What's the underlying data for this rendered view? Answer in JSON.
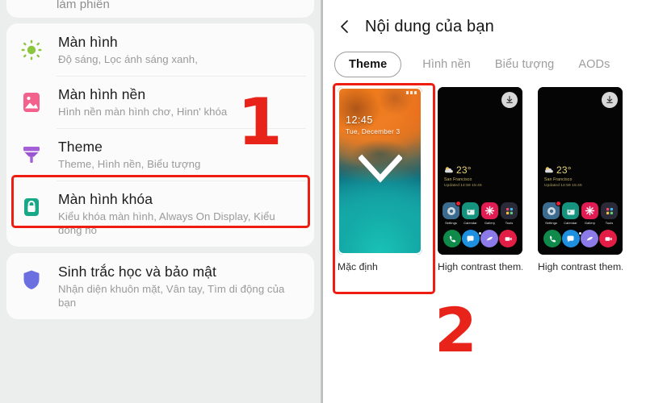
{
  "left_panel": {
    "partial_card_text": "làm phiền",
    "items": [
      {
        "title": "Màn hình",
        "subtitle": "Độ sáng, Lọc ánh sáng xanh,",
        "icon": "brightness-sun-icon",
        "icon_color": "#8cc63e"
      },
      {
        "title": "Màn hình nền",
        "subtitle": "Hình nền màn hình chơ, Hinn' khóa",
        "icon": "wallpaper-image-icon",
        "icon_color": "#f2628c"
      },
      {
        "title": "Theme",
        "subtitle": "Theme, Hình nền, Biểu tượng",
        "icon": "paint-roller-icon",
        "icon_color": "#a560d8"
      },
      {
        "title": "Màn hình khóa",
        "subtitle": "Kiểu khóa màn hình, Always On Display, Kiểu đồng hồ",
        "icon": "lock-icon",
        "icon_color": "#16a887"
      },
      {
        "title": "Sinh trắc học và bảo mật",
        "subtitle": "Nhận diện khuôn mặt, Vân tay, Tìm di động của bạn",
        "icon": "shield-icon",
        "icon_color": "#6b6fe0"
      }
    ]
  },
  "right_panel": {
    "back_icon": "back-chevron-icon",
    "title": "Nội dung của bạn",
    "tabs": [
      {
        "label": "Theme",
        "active": true
      },
      {
        "label": "Hình nền",
        "active": false
      },
      {
        "label": "Biểu tượng",
        "active": false
      },
      {
        "label": "AODs",
        "active": false
      }
    ],
    "themes": [
      {
        "label": "Mặc định",
        "kind": "gradient",
        "selected": true,
        "lock_time": "12:45",
        "lock_date": "Tue, December 3",
        "check_icon": "check-mark-icon"
      },
      {
        "label": "High contrast them...",
        "kind": "dark",
        "selected": false,
        "download_icon": "download-icon",
        "weather_temp": "23°",
        "weather_city": "San Francisco",
        "weather_updated": "Updated 14:59 15:45",
        "apps": [
          {
            "name": "Settings",
            "color": "#3b6b8f",
            "glyph": "gear-icon",
            "badge": true
          },
          {
            "name": "Calendar",
            "color": "#16937f",
            "glyph": "calendar-icon",
            "badge": false
          },
          {
            "name": "Gallery",
            "color": "#e01c52",
            "glyph": "flower-icon",
            "badge": false
          },
          {
            "name": "Tools",
            "color": "#2a2a38",
            "glyph": "tools-grid-icon",
            "badge": false
          }
        ],
        "dock": [
          {
            "name": "phone-icon",
            "color": "#0f8a4a"
          },
          {
            "name": "messages-icon",
            "color": "#1f8fe0"
          },
          {
            "name": "browser-icon",
            "color": "#8b7ae8"
          },
          {
            "name": "camera-icon",
            "color": "#e41d46"
          }
        ]
      },
      {
        "label": "High contrast them...",
        "kind": "dark",
        "selected": false,
        "download_icon": "download-icon",
        "weather_temp": "23°",
        "weather_city": "San Francisco",
        "weather_updated": "Updated 14:59 15:45",
        "apps": [
          {
            "name": "Settings",
            "color": "#3b6b8f",
            "glyph": "gear-icon",
            "badge": true
          },
          {
            "name": "Calendar",
            "color": "#16937f",
            "glyph": "calendar-icon",
            "badge": false
          },
          {
            "name": "Gallery",
            "color": "#e01c52",
            "glyph": "flower-icon",
            "badge": false
          },
          {
            "name": "Tools",
            "color": "#2a2a38",
            "glyph": "tools-grid-icon",
            "badge": false
          }
        ],
        "dock": [
          {
            "name": "phone-icon",
            "color": "#0f8a4a"
          },
          {
            "name": "messages-icon",
            "color": "#1f8fe0"
          },
          {
            "name": "browser-icon",
            "color": "#8b7ae8"
          },
          {
            "name": "camera-icon",
            "color": "#e41d46"
          }
        ]
      }
    ]
  },
  "annotations": {
    "step_one": "1",
    "step_two": "2",
    "highlight_color": "#ee1c11"
  }
}
